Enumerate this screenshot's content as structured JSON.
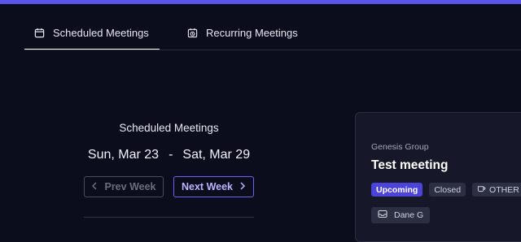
{
  "tabs": [
    {
      "label": "Scheduled Meetings",
      "icon": "calendar-icon",
      "active": true
    },
    {
      "label": "Recurring Meetings",
      "icon": "calendar-clock-icon",
      "active": false
    }
  ],
  "week_panel": {
    "title": "Scheduled Meetings",
    "start": "Sun, Mar 23",
    "separator": "-",
    "end": "Sat, Mar 29",
    "prev_label": "Prev Week",
    "next_label": "Next Week"
  },
  "meeting": {
    "group": "Genesis Group",
    "title": "Test meeting",
    "status": "Upcoming",
    "access": "Closed",
    "type": "OTHER",
    "owner": "Dane G"
  },
  "colors": {
    "accent": "#5b54e8",
    "background": "#0b0c1c",
    "card": "#161829"
  }
}
